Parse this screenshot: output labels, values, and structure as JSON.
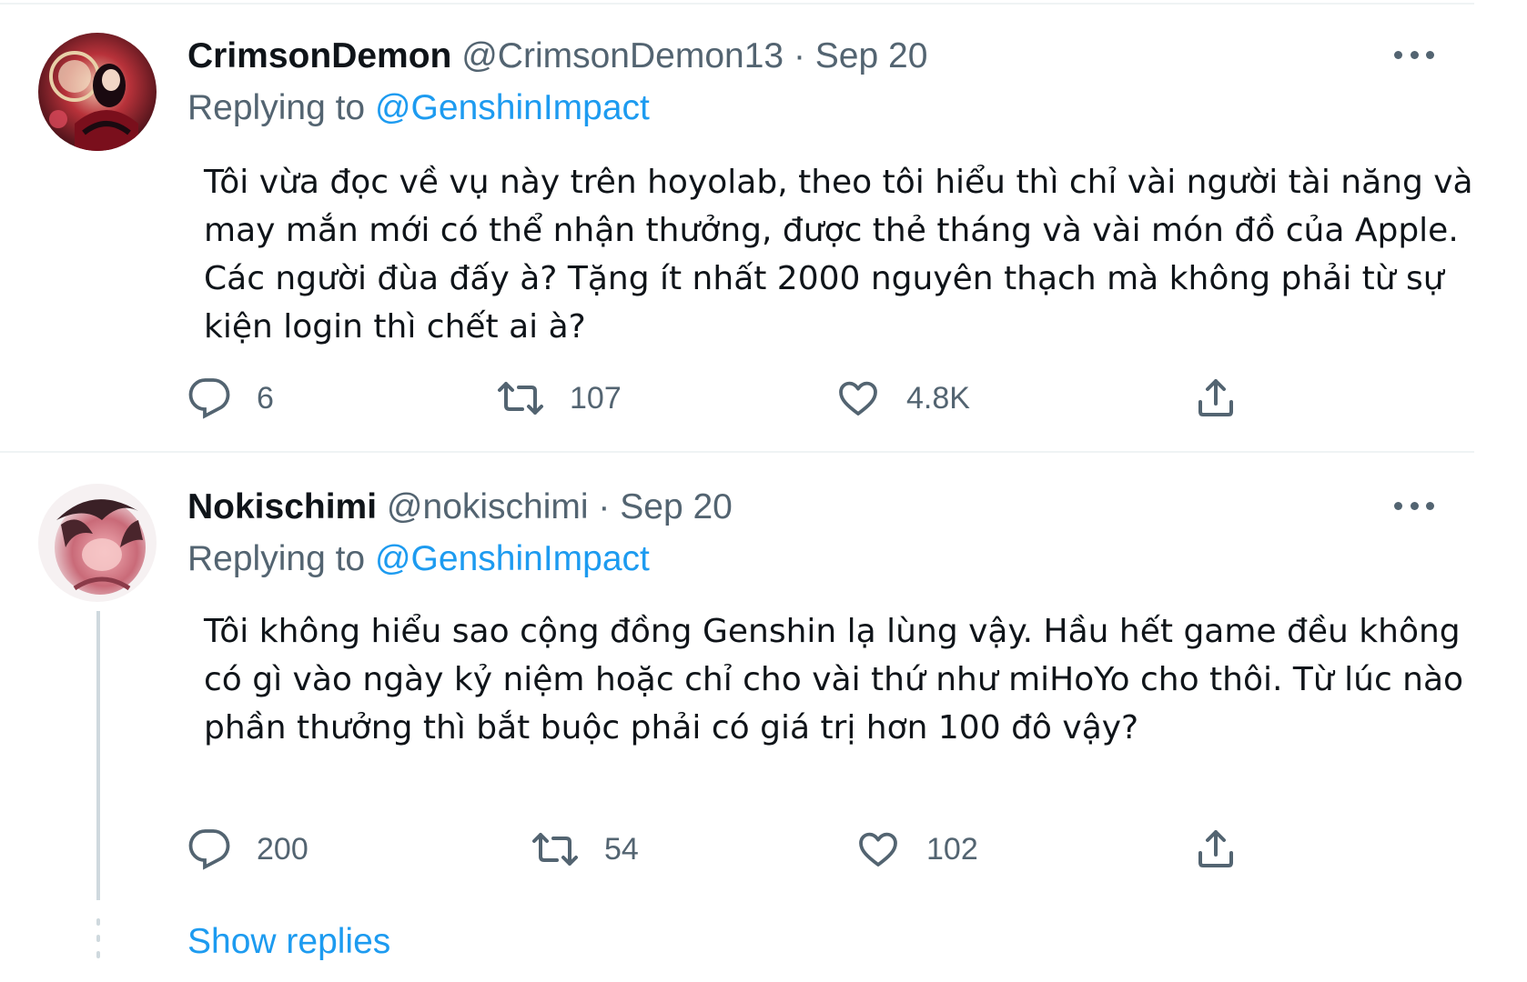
{
  "tweets": [
    {
      "display_name": "CrimsonDemon",
      "handle": "@CrimsonDemon13",
      "separator": "·",
      "date": "Sep 20",
      "replying_prefix": "Replying to",
      "replying_to": "@GenshinImpact",
      "text": "Tôi vừa đọc về vụ này trên hoyolab, theo tôi hiểu thì chỉ vài người tài năng và may mắn mới có thể nhận thưởng, được thẻ tháng và vài món đồ của Apple. Các người đùa đấy à? Tặng ít nhất 2000 nguyên thạch mà không phải từ sự kiện login thì chết ai à?",
      "replies": "6",
      "retweets": "107",
      "likes": "4.8K",
      "icons": [
        "reply-icon",
        "retweet-icon",
        "like-icon",
        "share-icon",
        "more-icon"
      ]
    },
    {
      "display_name": "Nokischimi",
      "handle": "@nokischimi",
      "separator": "·",
      "date": "Sep 20",
      "replying_prefix": "Replying to",
      "replying_to": "@GenshinImpact",
      "text": "Tôi không hiểu sao cộng đồng Genshin lạ lùng vậy. Hầu hết game đều không có gì vào ngày kỷ niệm hoặc chỉ cho vài thứ như miHoYo cho thôi. Từ lúc nào phần thưởng thì bắt buộc phải có giá trị hơn 100 đô vậy?",
      "replies": "200",
      "retweets": "54",
      "likes": "102",
      "icons": [
        "reply-icon",
        "retweet-icon",
        "like-icon",
        "share-icon",
        "more-icon"
      ]
    }
  ],
  "thread": {
    "show_replies": "Show replies"
  },
  "colors": {
    "text_primary": "#0f1419",
    "text_secondary": "#536471",
    "link": "#1d9bf0",
    "divider": "#eff3f4",
    "thread_line": "#cfd9de"
  }
}
